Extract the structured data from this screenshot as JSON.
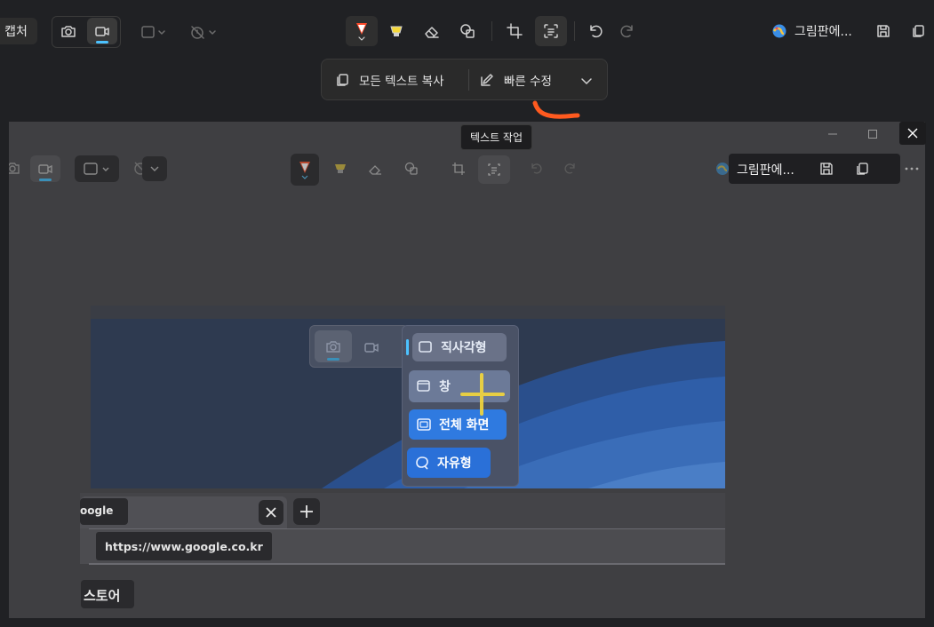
{
  "toolbar": {
    "capture_label": "캡처",
    "paint_label": "그림판에..."
  },
  "ocr_bar": {
    "copy_all_label": "모든 텍스트 복사",
    "quick_edit_label": "빠른 수정"
  },
  "tooltip": {
    "text": "텍스트 작업"
  },
  "inner_window": {
    "paint_label": "그림판에...",
    "snip_menu": {
      "items": [
        {
          "label": "직사각형"
        },
        {
          "label": "창"
        },
        {
          "label": "전체 화면"
        },
        {
          "label": "자유형"
        }
      ]
    },
    "browser": {
      "tab_title": "oogle",
      "url": "https://www.google.co.kr",
      "store_label": "스토어"
    }
  },
  "colors": {
    "accent": "#4cc2ff",
    "annotation_orange": "#ff5a1f",
    "highlight_yellow": "#f5d83a",
    "menu_blue": "#2f7ae0"
  }
}
